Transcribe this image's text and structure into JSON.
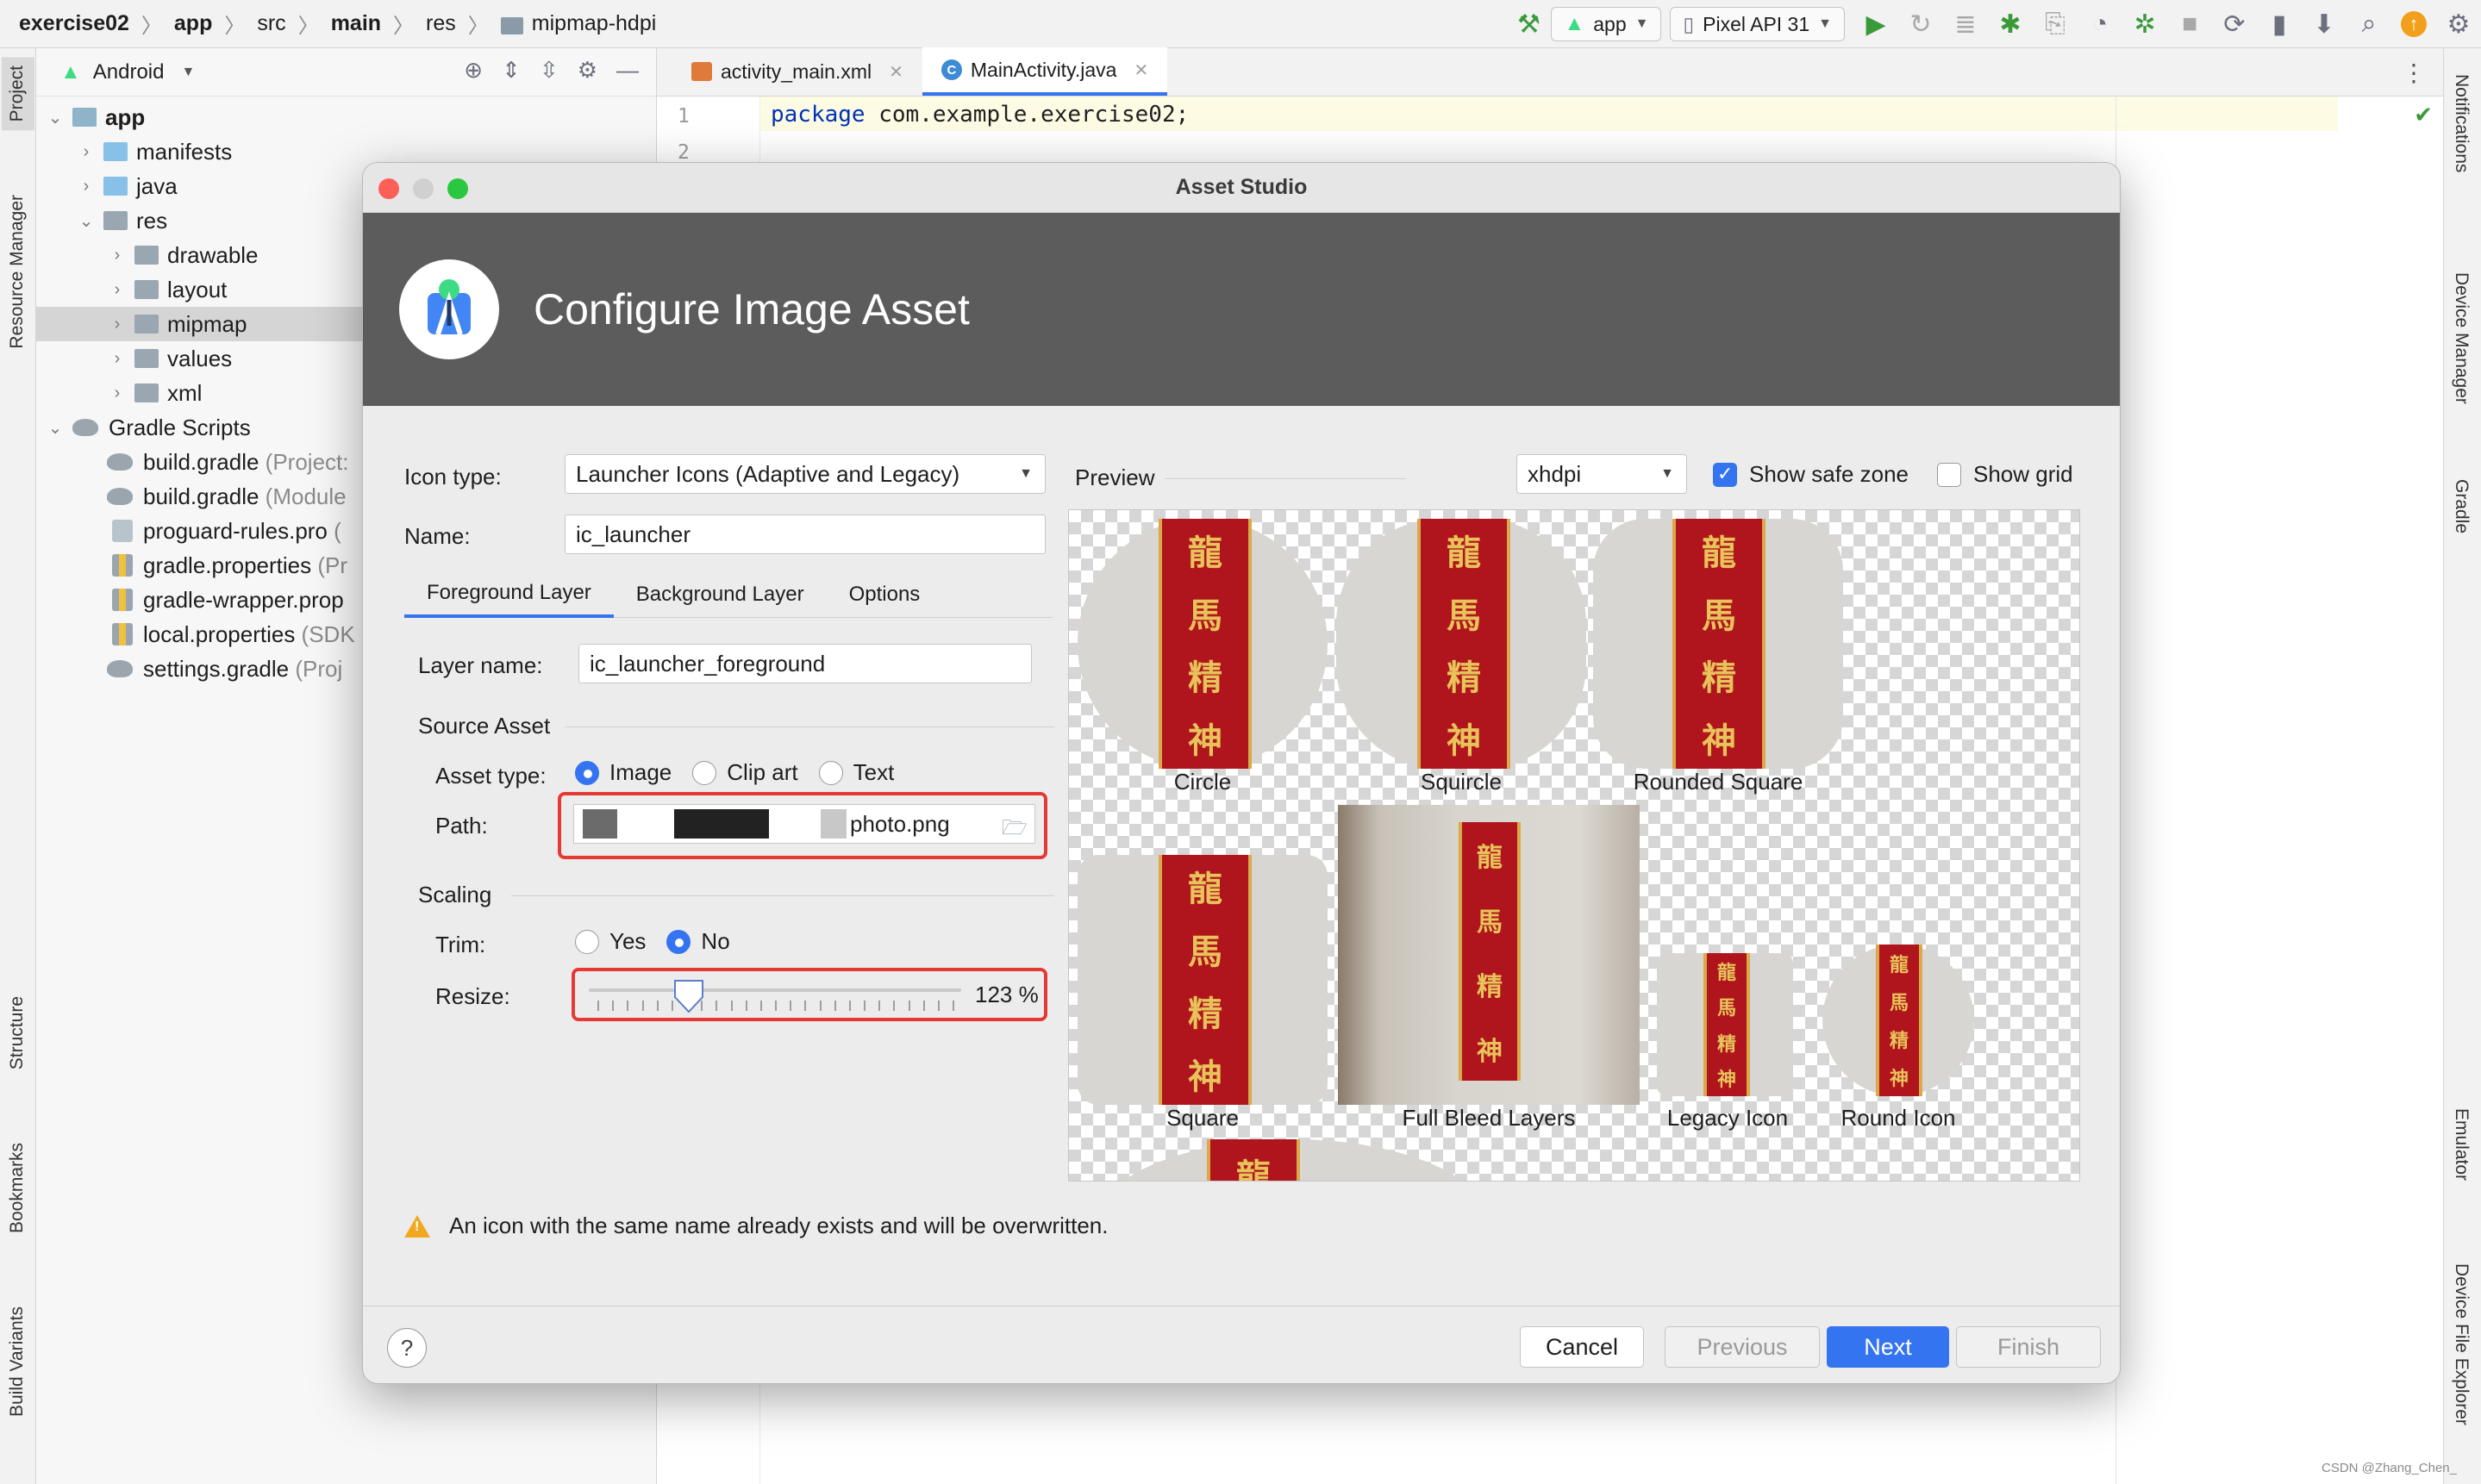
{
  "breadcrumbs": [
    {
      "label": "exercise02",
      "bold": true
    },
    {
      "label": "app",
      "bold": true
    },
    {
      "label": "src",
      "bold": false
    },
    {
      "label": "main",
      "bold": true
    },
    {
      "label": "res",
      "bold": false
    },
    {
      "label": "mipmap-hdpi",
      "bold": false
    }
  ],
  "toolbar": {
    "run_config": "app",
    "device": "Pixel API 31"
  },
  "left_tool_tabs": [
    "Project",
    "Resource Manager",
    "Structure",
    "Bookmarks",
    "Build Variants"
  ],
  "right_tool_tabs": [
    "Notifications",
    "Device Manager",
    "Gradle",
    "Emulator",
    "Device File Explorer"
  ],
  "project_panel": {
    "view_mode": "Android",
    "tree": [
      {
        "label": "app",
        "hint": "",
        "bold": true
      },
      {
        "label": "manifests",
        "hint": ""
      },
      {
        "label": "java",
        "hint": ""
      },
      {
        "label": "res",
        "hint": ""
      },
      {
        "label": "drawable",
        "hint": ""
      },
      {
        "label": "layout",
        "hint": ""
      },
      {
        "label": "mipmap",
        "hint": ""
      },
      {
        "label": "values",
        "hint": ""
      },
      {
        "label": "xml",
        "hint": ""
      },
      {
        "label": "Gradle Scripts",
        "hint": ""
      },
      {
        "label": "build.gradle",
        "hint": "(Project:"
      },
      {
        "label": "build.gradle",
        "hint": "(Module"
      },
      {
        "label": "proguard-rules.pro",
        "hint": "("
      },
      {
        "label": "gradle.properties",
        "hint": "(Pr"
      },
      {
        "label": "gradle-wrapper.prop",
        "hint": ""
      },
      {
        "label": "local.properties",
        "hint": "(SDK"
      },
      {
        "label": "settings.gradle",
        "hint": "(Proj"
      }
    ]
  },
  "editor": {
    "tabs": [
      "activity_main.xml",
      "MainActivity.java"
    ],
    "line_numbers": [
      "1",
      "2"
    ],
    "code_keyword": "package",
    "code_rest": " com.example.exercise02;"
  },
  "dialog": {
    "window_title": "Asset Studio",
    "heading": "Configure Image Asset",
    "icon_type_label": "Icon type:",
    "icon_type_value": "Launcher Icons (Adaptive and Legacy)",
    "name_label": "Name:",
    "name_value": "ic_launcher",
    "layer_tabs": [
      "Foreground Layer",
      "Background Layer",
      "Options"
    ],
    "layer_name_label": "Layer name:",
    "layer_name_value": "ic_launcher_foreground",
    "source_asset_label": "Source Asset",
    "asset_type_label": "Asset type:",
    "asset_types": [
      "Image",
      "Clip art",
      "Text"
    ],
    "asset_type_selected": "Image",
    "path_label": "Path:",
    "path_value_visible": "photo.png",
    "scaling_label": "Scaling",
    "trim_label": "Trim:",
    "trim_options": [
      "Yes",
      "No"
    ],
    "trim_selected": "No",
    "resize_label": "Resize:",
    "resize_value": "123 %",
    "resize_fraction": 0.23,
    "preview_label": "Preview",
    "density": "xhdpi",
    "show_safe_zone_label": "Show safe zone",
    "show_safe_zone": true,
    "show_grid_label": "Show grid",
    "show_grid": false,
    "preview_items": [
      "Circle",
      "Squircle",
      "Rounded Square",
      "Square",
      "Full Bleed Layers",
      "Legacy Icon",
      "Round Icon"
    ],
    "banner_glyphs": [
      "龍",
      "馬",
      "精",
      "神"
    ],
    "warning": "An icon with the same name already exists and will be overwritten.",
    "buttons": {
      "help": "?",
      "cancel": "Cancel",
      "previous": "Previous",
      "next": "Next",
      "finish": "Finish"
    }
  },
  "watermark": "CSDN @Zhang_Chen_",
  "colors": {
    "accent": "#3574f0",
    "highlight_box": "#e53935",
    "banner_bg": "#5c5c5c",
    "warning": "#f0a81e"
  }
}
